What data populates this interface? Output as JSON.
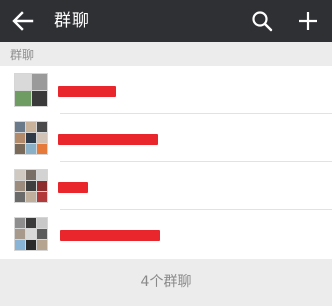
{
  "header": {
    "title": "群聊",
    "back_icon": "back-arrow-icon",
    "search_icon": "search-icon",
    "add_icon": "plus-icon",
    "background": "#2f3034"
  },
  "section": {
    "label": "群聊"
  },
  "groups": [
    {
      "name_redacted": true
    },
    {
      "name_redacted": true
    },
    {
      "name_redacted": true
    },
    {
      "name_redacted": true
    }
  ],
  "footer": {
    "count_label": "4个群聊"
  },
  "colors": {
    "redaction": "#e8262b",
    "page_background": "#ececec"
  }
}
